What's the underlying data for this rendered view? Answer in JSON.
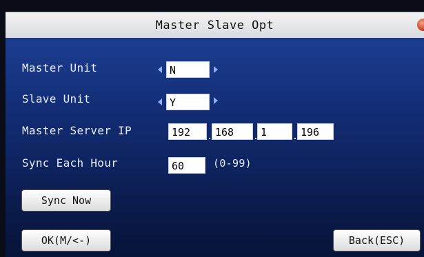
{
  "window": {
    "title": "Master Slave Opt"
  },
  "form": {
    "master_unit": {
      "label": "Master Unit",
      "value": "N"
    },
    "slave_unit": {
      "label": "Slave Unit",
      "value": "Y"
    },
    "master_server_ip": {
      "label": "Master Server IP",
      "octets": [
        "192",
        "168",
        "1",
        "196"
      ]
    },
    "sync_each_hour": {
      "label": "Sync Each Hour",
      "value": "60",
      "range_hint": "(0-99)"
    }
  },
  "buttons": {
    "sync_now": "Sync Now",
    "ok": "OK(M/<-)",
    "back": "Back(ESC)"
  },
  "colors": {
    "title_bar": "#e6e7ea",
    "background_top": "#1c3d90",
    "background_bottom": "#07143a",
    "close_icon": "#c43a1e"
  }
}
